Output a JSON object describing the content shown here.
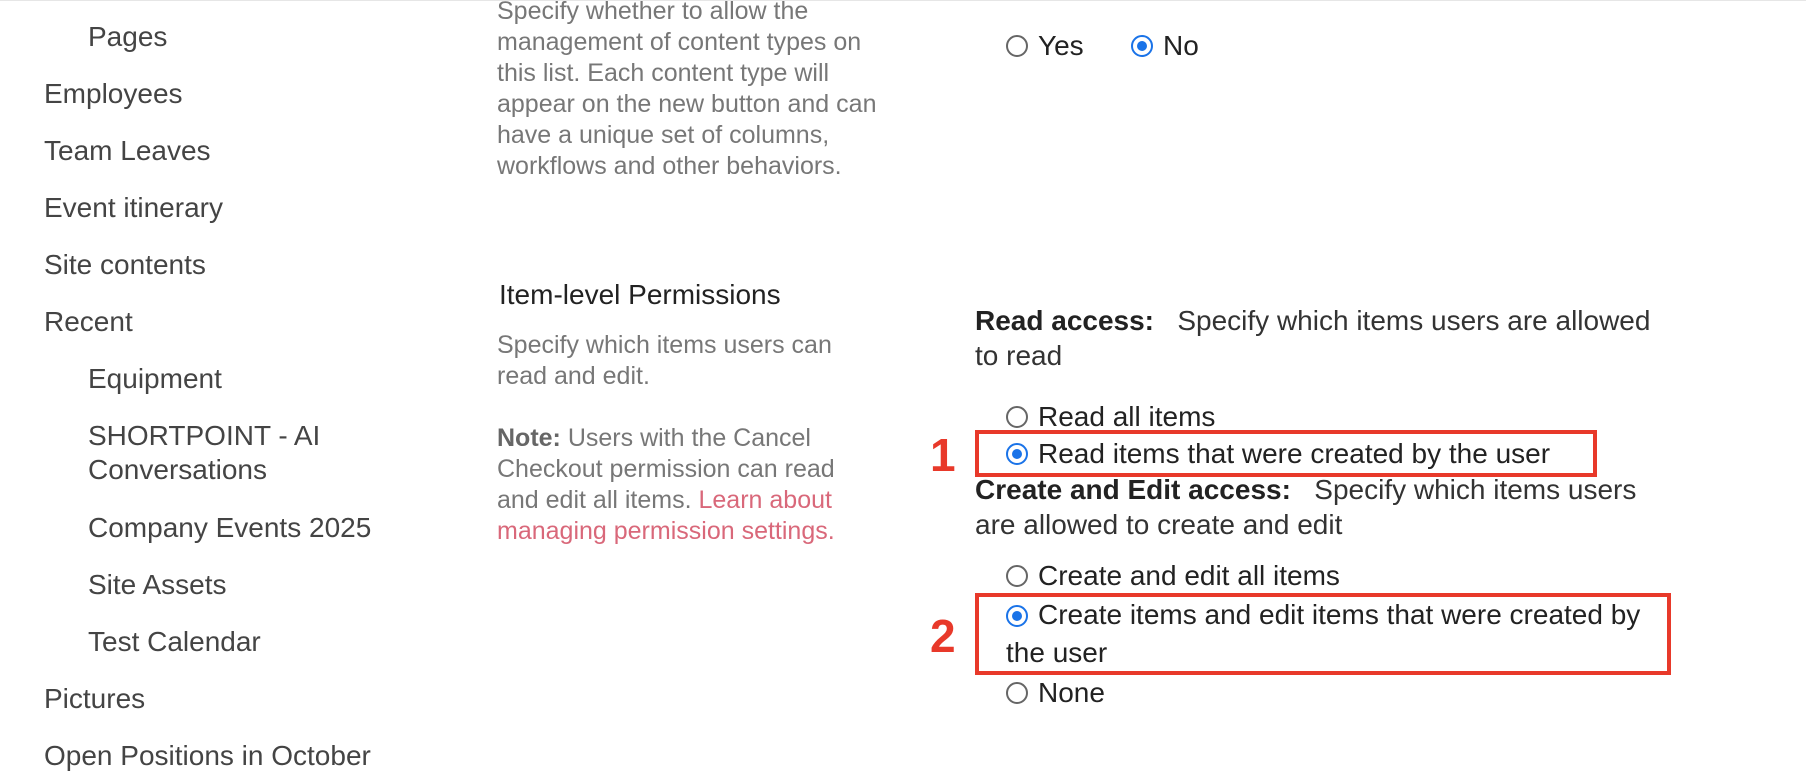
{
  "nav": {
    "items": [
      {
        "label": "Pages",
        "level": 1
      },
      {
        "label": "Employees",
        "level": 0
      },
      {
        "label": "Team Leaves",
        "level": 0
      },
      {
        "label": "Event itinerary",
        "level": 0
      },
      {
        "label": "Site contents",
        "level": 0
      },
      {
        "label": "Recent",
        "level": 0
      },
      {
        "label": "Equipment",
        "level": 1
      },
      {
        "label": "SHORTPOINT - AI Conversations",
        "level": 1
      },
      {
        "label": "Company Events 2025",
        "level": 1
      },
      {
        "label": "Site Assets",
        "level": 1
      },
      {
        "label": "Test Calendar",
        "level": 1
      },
      {
        "label": "Pictures",
        "level": 0
      },
      {
        "label": "Open Positions in October",
        "level": 0
      }
    ]
  },
  "content_types": {
    "description": "Specify whether to allow the management of content types on this list. Each content type will appear on the new button and can have a unique set of columns, workflows and other behaviors.",
    "options": [
      {
        "label": "Yes",
        "selected": false
      },
      {
        "label": "No",
        "selected": true
      }
    ]
  },
  "item_permissions": {
    "title": "Item-level Permissions",
    "description": "Specify which items users can read and edit.",
    "note_label": "Note:",
    "note_text": " Users with the Cancel Checkout permission can read and edit all items. ",
    "note_link": "Learn about managing permission settings.",
    "read_access": {
      "label": "Read access:",
      "text": "Specify which items users are allowed to read",
      "options": [
        {
          "label": "Read all items",
          "selected": false
        },
        {
          "label": "Read items that were created by the user",
          "selected": true
        }
      ]
    },
    "edit_access": {
      "label": "Create and Edit access:",
      "text": "Specify which items users are allowed to create and edit",
      "options": [
        {
          "label": "Create and edit all items",
          "selected": false
        },
        {
          "label": "Create items and edit items that were created by the user",
          "selected": true
        },
        {
          "label": "None",
          "selected": false
        }
      ]
    }
  },
  "annotations": {
    "marker_1": "1",
    "marker_2": "2",
    "accent_color": "#e8392a",
    "radio_color": "#1a73e8"
  }
}
